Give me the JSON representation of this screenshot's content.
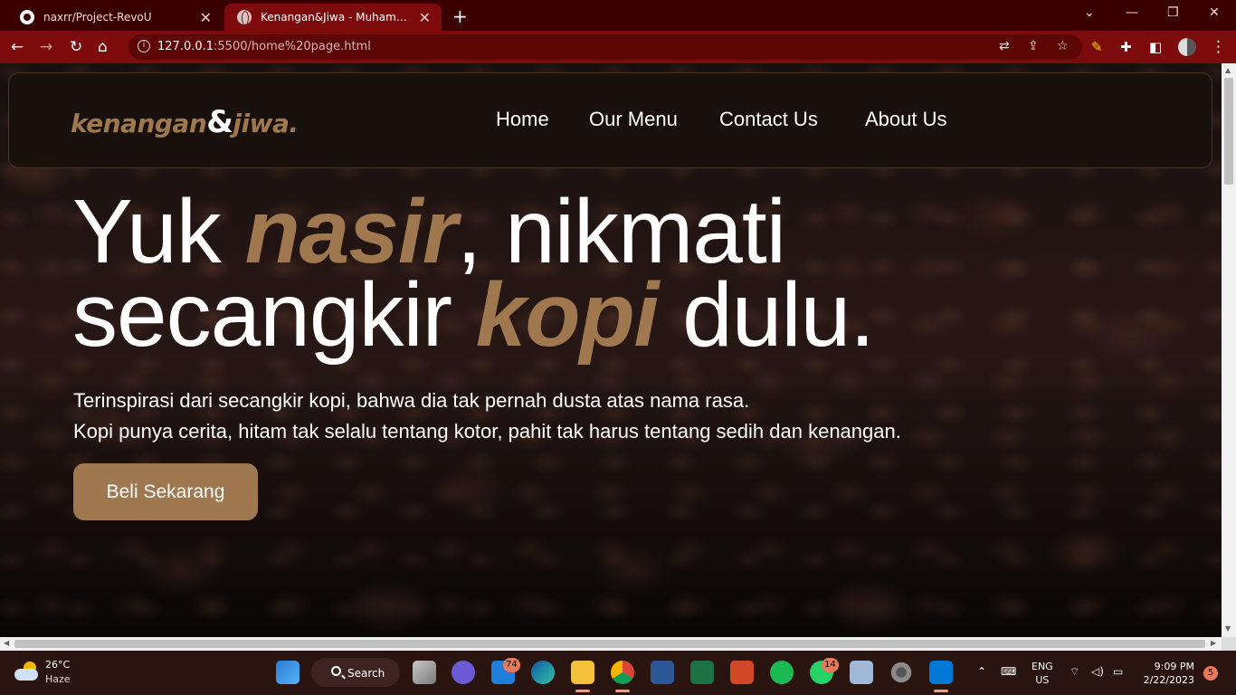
{
  "browser": {
    "tabs": [
      {
        "title": "naxrr/Project-RevoU",
        "active": false,
        "icon": "github-icon"
      },
      {
        "title": "Kenangan&Jiwa - Muhammad N",
        "active": true,
        "icon": "globe-icon"
      }
    ],
    "url_host": "127.0.0.1",
    "url_path": ":5500/home%20page.html",
    "theme_color": "#7d0b0b"
  },
  "site": {
    "logo_word1": "kenangan",
    "logo_amp": "&",
    "logo_word2": "jiwa.",
    "nav": [
      "Home",
      "Our Menu",
      "Contact Us",
      "About Us"
    ],
    "hero": {
      "line1_a": "Yuk ",
      "line1_accent": "nasir",
      "line1_b": ", nikmati",
      "line2_a": "secangkir ",
      "line2_accent": "kopi",
      "line2_b": " dulu.",
      "desc_line1": "Terinspirasi dari secangkir kopi, bahwa dia tak pernah dusta atas nama rasa.",
      "desc_line2": "Kopi punya cerita, hitam tak selalu tentang kotor, pahit tak harus tentang sedih dan kenangan."
    },
    "cta_label": "Beli Sekarang",
    "accent_color": "#a07850"
  },
  "taskbar": {
    "weather_temp": "26°C",
    "weather_cond": "Haze",
    "search_label": "Search",
    "badges": {
      "mail": "74",
      "whatsapp": "14",
      "notifications": "5"
    },
    "lang_line1": "ENG",
    "lang_line2": "US",
    "time": "9:09 PM",
    "date": "2/22/2023"
  }
}
